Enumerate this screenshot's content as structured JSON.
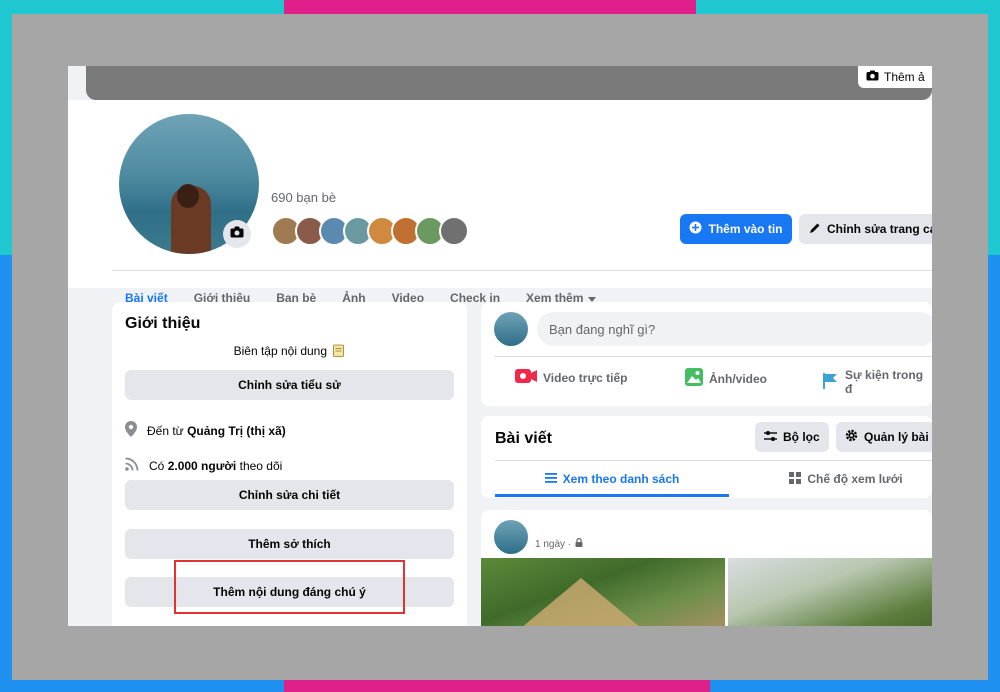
{
  "colors": {
    "accent": "#1877f2",
    "highlight": "#e03333"
  },
  "cover": {
    "button_label": "Thêm ả",
    "icon": "camera-icon"
  },
  "profile": {
    "friends_count": "690 bạn bè",
    "avatar_camera_icon": "camera-icon"
  },
  "header_buttons": {
    "add_story": "Thêm vào tin",
    "edit_profile": "Chỉnh sửa trang cá"
  },
  "tabs": [
    {
      "label": "Bài viết"
    },
    {
      "label": "Giới thiệu"
    },
    {
      "label": "Bạn bè"
    },
    {
      "label": "Ảnh"
    },
    {
      "label": "Video"
    },
    {
      "label": "Check in"
    },
    {
      "label": "Xem thêm"
    }
  ],
  "intro": {
    "title": "Giới thiệu",
    "bio_placeholder": "Biên tập nội dung",
    "edit_bio": "Chỉnh sửa tiểu sử",
    "from_prefix": "Đến từ",
    "from_place": "Quảng Trị (thị xã)",
    "followers_prefix": "Có",
    "followers_count": "2.000 người",
    "followers_suffix": "theo dõi",
    "edit_details": "Chỉnh sửa chi tiết",
    "add_hobbies": "Thêm sở thích",
    "add_featured": "Thêm nội dung đáng chú ý"
  },
  "composer": {
    "placeholder": "Bạn đang nghĩ gì?",
    "live_video": "Video trực tiếp",
    "photo_video": "Ảnh/video",
    "life_event": "Sự kiện trong đ"
  },
  "posts": {
    "title": "Bài viết",
    "filter": "Bộ lọc",
    "manage": "Quản lý bài",
    "list_view": "Xem theo danh sách",
    "grid_view": "Chế độ xem lưới"
  },
  "post": {
    "time": "1 ngày ·"
  }
}
